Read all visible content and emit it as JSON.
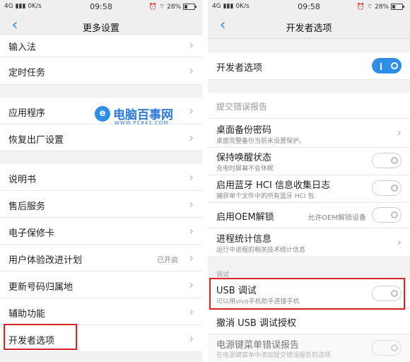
{
  "left": {
    "status": {
      "signal": "4G",
      "speed": "0K/s",
      "time": "09:58",
      "battery": "28%"
    },
    "title": "更多设置",
    "items": [
      {
        "label": "输入法"
      },
      {
        "label": "定时任务"
      },
      {
        "label": "应用程序"
      },
      {
        "label": "恢复出厂设置"
      },
      {
        "label": "说明书"
      },
      {
        "label": "售后服务"
      },
      {
        "label": "电子保修卡"
      },
      {
        "label": "用户体验改进计划",
        "value": "已开启"
      },
      {
        "label": "更新号码归属地"
      },
      {
        "label": "辅助功能"
      },
      {
        "label": "开发者选项"
      }
    ],
    "watermark": {
      "title": "电脑百事网",
      "url": "WWW.PC841.COM"
    }
  },
  "right": {
    "status": {
      "signal": "4G",
      "speed": "0K/s",
      "time": "09:58",
      "battery": "28%"
    },
    "title": "开发者选项",
    "dev_toggle": {
      "label": "开发者选项",
      "state": "on"
    },
    "section_report": "提交错误报告",
    "items": [
      {
        "label": "桌面备份密码",
        "sub": "桌面完整备份当前未设置保护。"
      },
      {
        "label": "保持唤醒状态",
        "sub": "充电时屏幕不会休眠",
        "state": "off"
      },
      {
        "label": "启用蓝牙 HCI 信息收集日志",
        "sub": "捕获单个文件中的所有蓝牙 HCI 包",
        "state": "off"
      },
      {
        "label": "启用OEM解锁",
        "value": "允许OEM解锁设备",
        "state": "off"
      },
      {
        "label": "进程统计信息",
        "sub": "运行中进程的相关技术统计信息"
      }
    ],
    "section_debug": "调试",
    "usb": {
      "label": "USB 调试",
      "sub": "可以用vivo手机助手连接手机",
      "state": "off"
    },
    "revoke": {
      "label": "撤消 USB 调试授权"
    },
    "power": {
      "label": "电源键菜单错误报告",
      "sub": "在电源键菜单中添加提交错误报告的选项",
      "state": "off"
    }
  }
}
